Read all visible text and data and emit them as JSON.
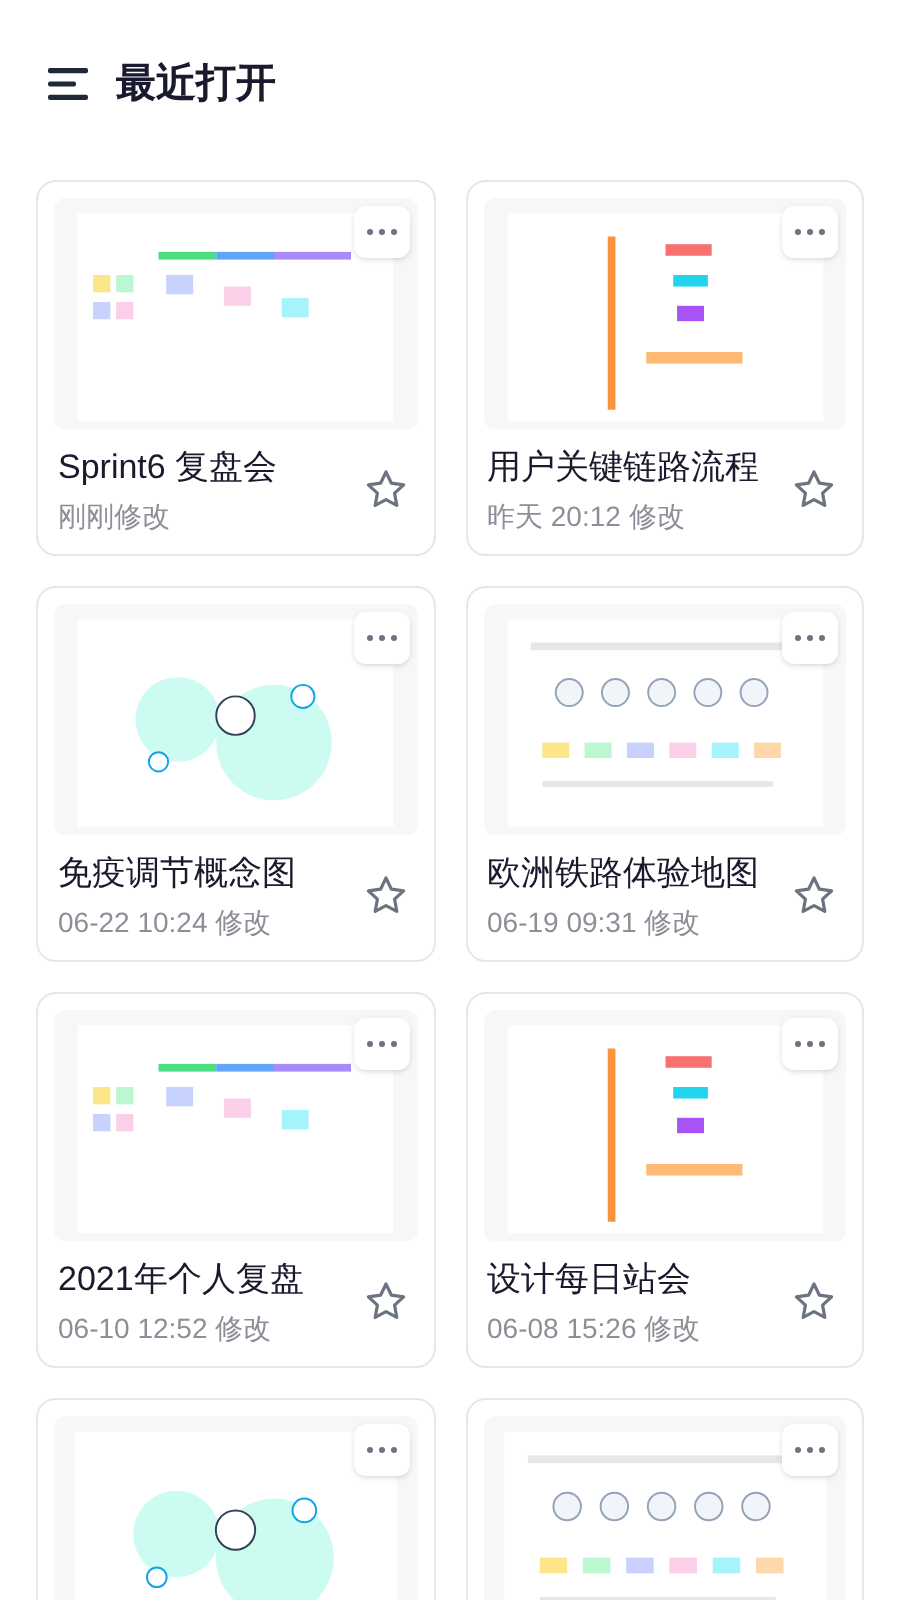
{
  "header": {
    "title": "最近打开"
  },
  "files": [
    {
      "thumbnail": {
        "kind": "picture"
      },
      "title": "Sprint6 复盘会",
      "time": "刚刚修改",
      "starred": false
    },
    {
      "thumbnail": {
        "kind": "picture"
      },
      "title": "用户关键链路流程",
      "time": "昨天 20:12 修改",
      "starred": false
    },
    {
      "thumbnail": {
        "kind": "picture"
      },
      "title": "免疫调节概念图",
      "time": "06-22 10:24 修改",
      "starred": false
    },
    {
      "thumbnail": {
        "kind": "picture"
      },
      "title": "欧洲铁路体验地图",
      "time": "06-19 09:31 修改",
      "starred": false
    },
    {
      "thumbnail": {
        "kind": "picture"
      },
      "title": "2021年个人复盘",
      "time": "06-10 12:52 修改",
      "starred": false
    },
    {
      "thumbnail": {
        "kind": "picture"
      },
      "title": "设计每日站会",
      "time": "06-08 15:26 修改",
      "starred": false
    },
    {
      "thumbnail": {
        "kind": "picture"
      }
    },
    {
      "thumbnail": {
        "kind": "picture"
      }
    }
  ]
}
